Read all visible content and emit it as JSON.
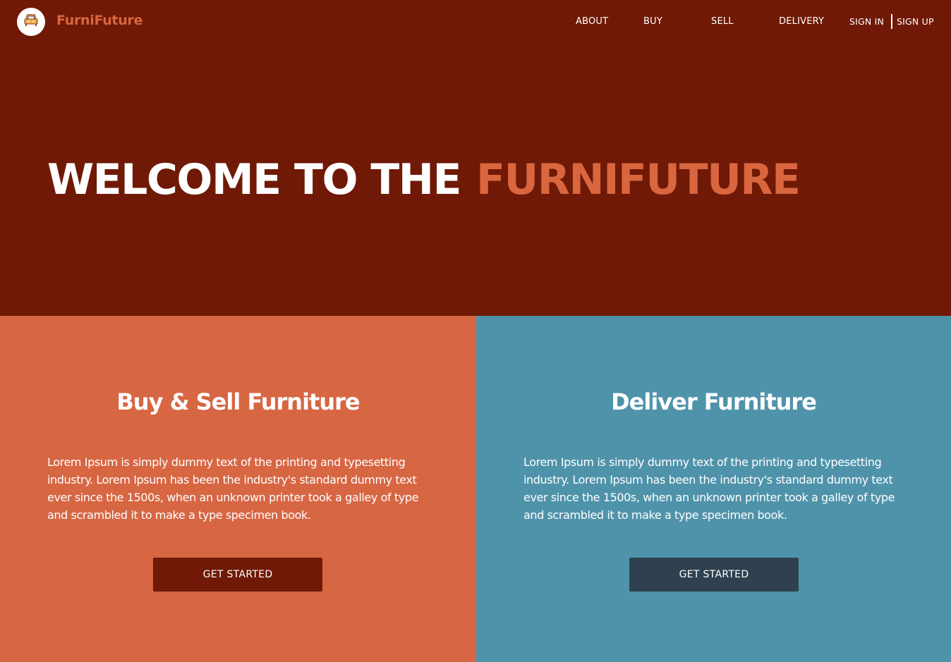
{
  "colors": {
    "header_bg": "#6f1906",
    "accent": "#d9663f",
    "left_panel_bg": "#d76643",
    "right_panel_bg": "#4f93aa",
    "left_button_bg": "#6f1906",
    "right_button_bg": "#2f4150",
    "text_light": "#ffffff"
  },
  "brand": {
    "name": "FurniFuture",
    "logo_icon": "sofa-icon"
  },
  "nav": {
    "items": [
      "ABOUT",
      "BUY",
      "SELL",
      "DELIVERY"
    ],
    "sign_in": "SIGN IN",
    "sign_up": "SIGN UP"
  },
  "hero": {
    "headline_prefix": "WELCOME TO THE",
    "headline_accent": "FURNIFUTURE"
  },
  "panels": [
    {
      "title": "Buy & Sell Furniture",
      "body": "Lorem Ipsum is simply dummy text of the printing and typesetting industry. Lorem Ipsum has been the industry's standard dummy text ever since the 1500s, when an unknown printer took a galley of type and scrambled it to make a type specimen book.",
      "button": "GET STARTED"
    },
    {
      "title": "Deliver Furniture",
      "body": "Lorem Ipsum is simply dummy text of the printing and typesetting industry. Lorem Ipsum has been the industry's standard dummy text ever since the 1500s, when an unknown printer took a galley of type and scrambled it to make a type specimen book.",
      "button": "GET STARTED"
    }
  ]
}
